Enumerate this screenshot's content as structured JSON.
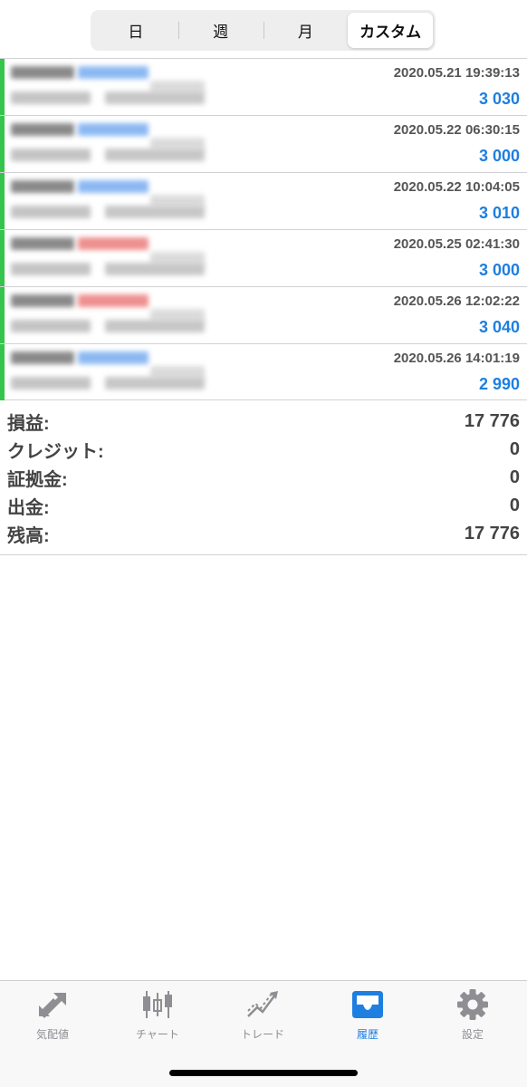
{
  "period_tabs": [
    {
      "label": "日",
      "active": false
    },
    {
      "label": "週",
      "active": false
    },
    {
      "label": "月",
      "active": false
    },
    {
      "label": "カスタム",
      "active": true
    }
  ],
  "deals": [
    {
      "time": "2020.05.21 19:39:13",
      "profit": "3 030",
      "direction": "buy"
    },
    {
      "time": "2020.05.22 06:30:15",
      "profit": "3 000",
      "direction": "buy"
    },
    {
      "time": "2020.05.22 10:04:05",
      "profit": "3 010",
      "direction": "buy"
    },
    {
      "time": "2020.05.25 02:41:30",
      "profit": "3 000",
      "direction": "sell"
    },
    {
      "time": "2020.05.26 12:02:22",
      "profit": "3 040",
      "direction": "sell"
    },
    {
      "time": "2020.05.26 14:01:19",
      "profit": "2 990",
      "direction": "buy"
    }
  ],
  "summary": {
    "profit": {
      "label": "損益:",
      "value": "17 776"
    },
    "credit": {
      "label": "クレジット:",
      "value": "0"
    },
    "margin": {
      "label": "証拠金:",
      "value": "0"
    },
    "withdrawal": {
      "label": "出金:",
      "value": "0"
    },
    "balance": {
      "label": "残高:",
      "value": "17 776"
    }
  },
  "tabbar": [
    {
      "label": "気配値",
      "icon": "quotes-arrows-icon",
      "active": false
    },
    {
      "label": "チャート",
      "icon": "candlestick-chart-icon",
      "active": false
    },
    {
      "label": "トレード",
      "icon": "trade-trend-icon",
      "active": false
    },
    {
      "label": "履歴",
      "icon": "history-inbox-icon",
      "active": true
    },
    {
      "label": "設定",
      "icon": "settings-gear-icon",
      "active": false
    }
  ],
  "colors": {
    "accent": "#1e7fe0",
    "buy_stripe": "#35c44c",
    "tab_inactive": "#8e8e93"
  }
}
